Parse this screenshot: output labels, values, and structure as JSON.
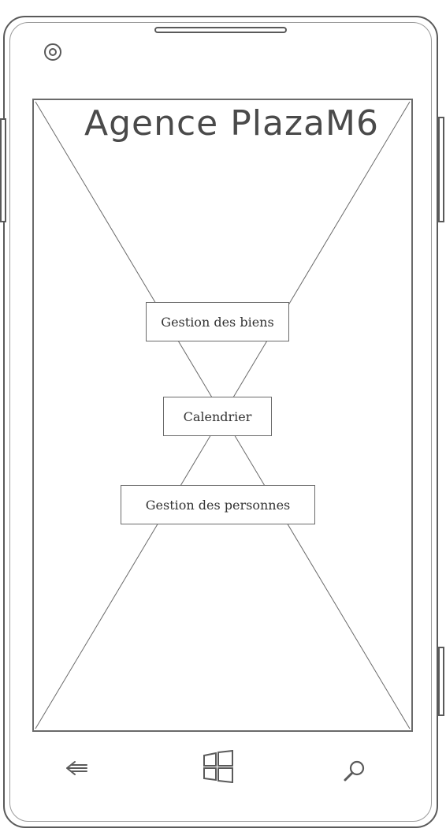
{
  "app": {
    "title": "Agence PlazaM6"
  },
  "menu": {
    "gestion_biens": "Gestion des biens",
    "calendrier": "Calendrier",
    "gestion_personnes": "Gestion des personnes"
  },
  "nav": {
    "back_icon": "back-arrow-icon",
    "home_icon": "windows-logo-icon",
    "search_icon": "search-icon"
  },
  "colors": {
    "outline": "#5a5a5a",
    "text": "#333333"
  }
}
